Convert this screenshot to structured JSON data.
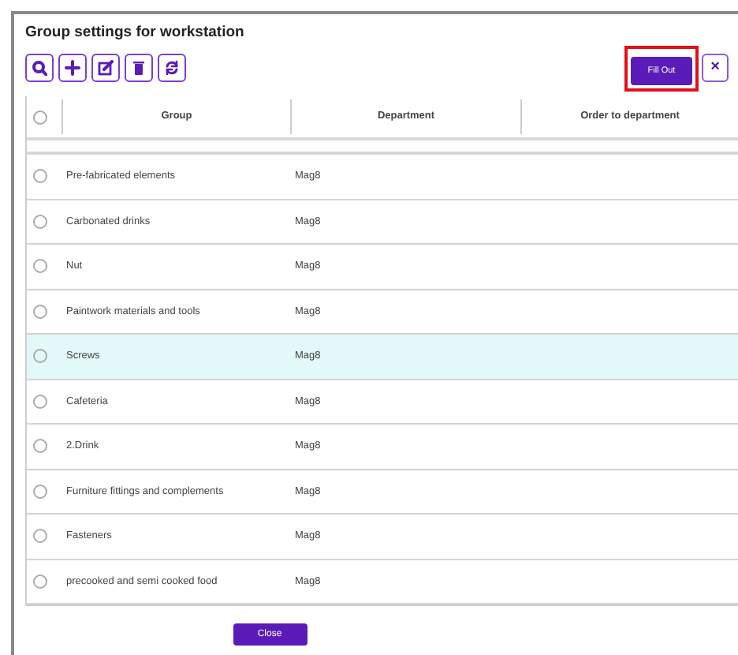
{
  "window": {
    "title": "Group settings for workstation"
  },
  "toolbar": [
    {
      "kind": "search"
    },
    {
      "kind": "add"
    },
    {
      "kind": "edit"
    },
    {
      "kind": "delete"
    },
    {
      "kind": "refresh"
    }
  ],
  "fill_out_button": {
    "label": "Fill Out",
    "highlighted": true
  },
  "close_icon_button": {
    "label": "×"
  },
  "table": {
    "select_all": {
      "checked": false
    },
    "columns": [
      "Group",
      "Department",
      "Order to department"
    ],
    "rows": [
      {
        "group": "Pre-fabricated elements",
        "department": "Mag8",
        "checked": false,
        "highlighted": false
      },
      {
        "group": "Carbonated drinks",
        "department": "Mag8",
        "checked": false,
        "highlighted": false
      },
      {
        "group": "Nut",
        "department": "Mag8",
        "checked": false,
        "highlighted": false
      },
      {
        "group": "Paintwork materials and tools",
        "department": "Mag8",
        "checked": false,
        "highlighted": false
      },
      {
        "group": "Screws",
        "department": "Mag8",
        "checked": false,
        "highlighted": true
      },
      {
        "group": "Cafeteria",
        "department": "Mag8",
        "checked": false,
        "highlighted": false
      },
      {
        "group": "2.Drink",
        "department": "Mag8",
        "checked": false,
        "highlighted": false
      },
      {
        "group": "Furniture fittings and complements",
        "department": "Mag8",
        "checked": false,
        "highlighted": false
      },
      {
        "group": "Fasteners",
        "department": "Mag8",
        "checked": false,
        "highlighted": false
      },
      {
        "group": "precooked and semi cooked food",
        "department": "Mag8",
        "checked": false,
        "highlighted": false
      }
    ]
  },
  "close_button": {
    "label": "Close"
  }
}
